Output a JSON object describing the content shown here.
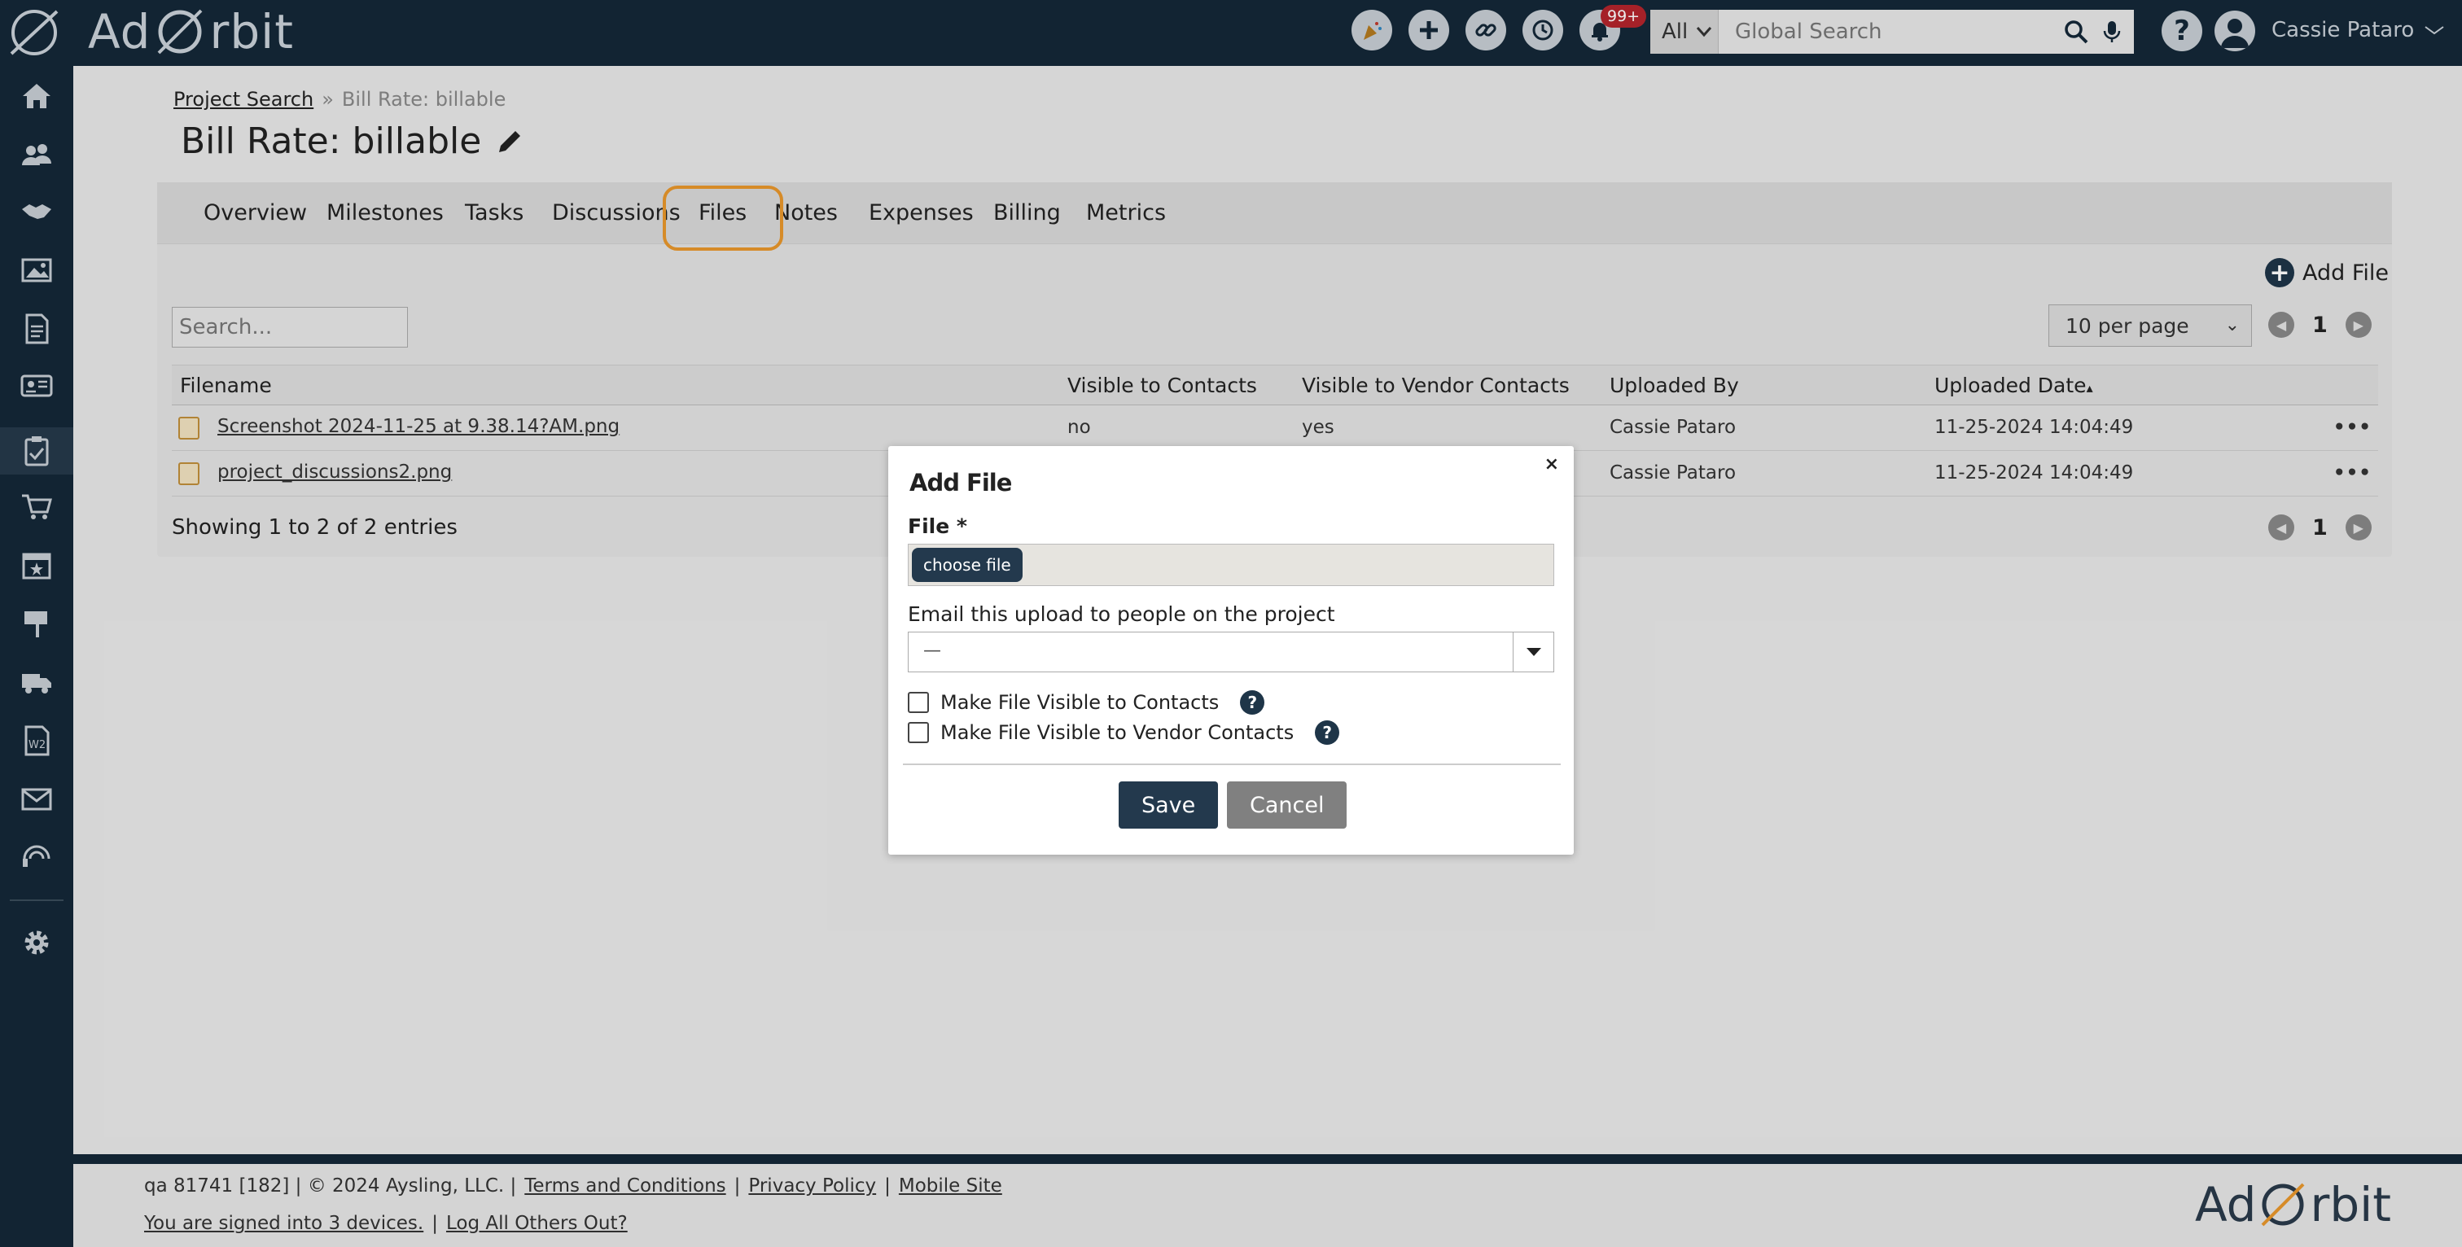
{
  "app": {
    "logo_text_left": "Ad",
    "logo_text_right": "rbit"
  },
  "topbar": {
    "icons": [
      "party-icon",
      "plus-icon",
      "link-icon",
      "history-icon",
      "bell-icon"
    ],
    "notification_badge": "99+",
    "search_scope": "All",
    "search_placeholder": "Global Search",
    "user_name": "Cassie Pataro"
  },
  "sidebar": {
    "items": [
      "home-icon",
      "people-icon",
      "handshake-icon",
      "image-icon",
      "document-icon",
      "id-card-icon",
      "clipboard-icon",
      "cart-icon",
      "calendar-icon",
      "sign-icon",
      "truck-icon",
      "w2-icon",
      "mail-icon",
      "support-icon",
      "gear-icon"
    ]
  },
  "breadcrumb": {
    "link": "Project Search",
    "separator": "»",
    "current": "Bill Rate: billable"
  },
  "page": {
    "title": "Bill Rate: billable"
  },
  "tabs": [
    "Overview",
    "Milestones",
    "Tasks",
    "Discussions",
    "Files",
    "Notes",
    "Expenses",
    "Billing",
    "Metrics"
  ],
  "files": {
    "add_label": "Add File",
    "search_placeholder": "Search...",
    "per_page": "10 per page",
    "page_number": "1",
    "columns": [
      "Filename",
      "Visible to Contacts",
      "Visible to Vendor Contacts",
      "Uploaded By",
      "Uploaded Date"
    ],
    "sort_marker": "▴",
    "rows": [
      {
        "filename": "Screenshot 2024-11-25 at 9.38.14?AM.png",
        "visible_contacts": "no",
        "visible_vendor": "yes",
        "uploaded_by": "Cassie Pataro",
        "uploaded_date": "11-25-2024 14:04:49"
      },
      {
        "filename": "project_discussions2.png",
        "visible_contacts": "",
        "visible_vendor": "",
        "uploaded_by": "Cassie Pataro",
        "uploaded_date": "11-25-2024 14:04:49"
      }
    ],
    "entries_text": "Showing 1 to 2 of 2 entries"
  },
  "modal": {
    "title": "Add File",
    "close": "×",
    "file_label": "File *",
    "choose_file": "choose file",
    "email_label": "Email this upload to people on the project",
    "email_value": "—",
    "checkbox_contacts": "Make File Visible to Contacts",
    "checkbox_vendor": "Make File Visible to Vendor Contacts",
    "help": "?",
    "save": "Save",
    "cancel": "Cancel"
  },
  "footer": {
    "info": "qa 81741 [182] | © 2024 Aysling, LLC. |",
    "terms": "Terms and Conditions",
    "sep": "|",
    "privacy": "Privacy Policy",
    "mobile": "Mobile Site",
    "devices": "You are signed into 3 devices.",
    "logout": "Log All Others Out?",
    "logo_left": "Ad",
    "logo_right": "rbit"
  },
  "colors": {
    "nav_bg": "#142838",
    "accent_highlight": "#e9972c",
    "primary_button": "#23394d",
    "cancel_button": "#808080",
    "badge": "#b3242c"
  }
}
